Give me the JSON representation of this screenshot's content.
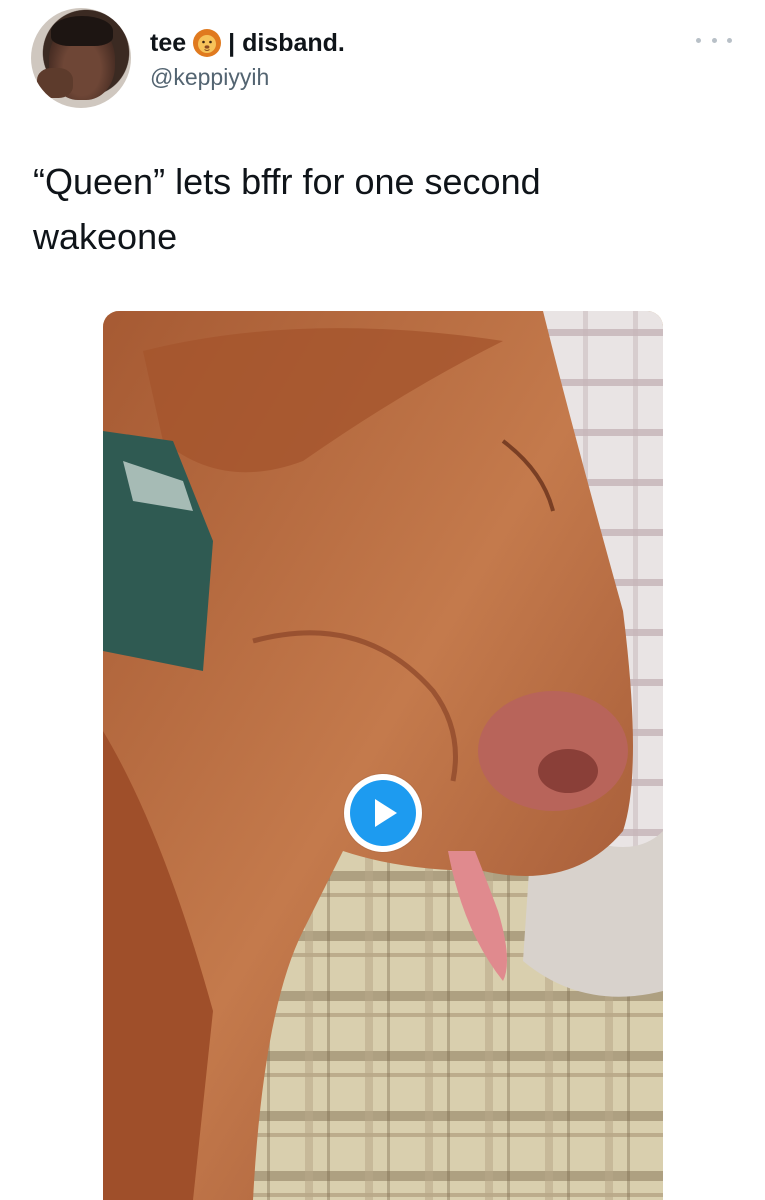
{
  "tweet": {
    "author": {
      "name_prefix": "tee",
      "name_emoji_icon": "lion-face-emoji",
      "name_suffix": "| disband.",
      "handle": "@keppiyyih"
    },
    "text_lines": [
      "“Queen” lets bffr for one second",
      "wakeone"
    ],
    "media": {
      "type": "video",
      "play_icon": "play-icon",
      "accent_color": "#1d9bf0"
    },
    "more_icon": "more-horizontal-icon"
  },
  "colors": {
    "name": "#0f1419",
    "handle": "#536471",
    "more_dots": "#b8c0c7",
    "play_button": "#1d9bf0"
  }
}
